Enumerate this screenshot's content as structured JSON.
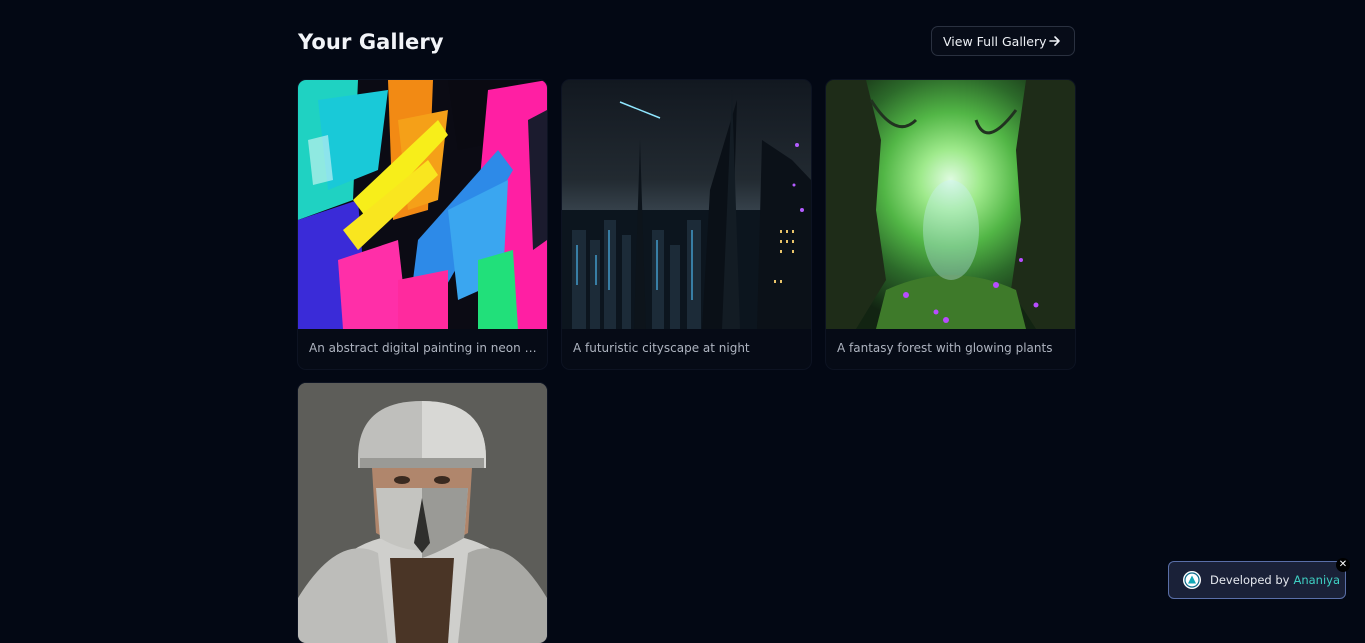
{
  "gallery": {
    "title": "Your Gallery",
    "view_full_label": "View Full Gallery"
  },
  "images": [
    {
      "caption": "An abstract digital painting in neon colors",
      "icon": "abstract-painting"
    },
    {
      "caption": "A futuristic cityscape at night",
      "icon": "cityscape"
    },
    {
      "caption": "A fantasy forest with glowing plants",
      "icon": "forest"
    },
    {
      "caption": "",
      "icon": "knight-portrait"
    }
  ],
  "badge": {
    "prefix": "Developed by",
    "author": "Ananiya",
    "close_glyph": "✕",
    "accent_color": "#3fd0c3"
  },
  "colors": {
    "background": "#030814",
    "badge_border": "#5a6fa8"
  }
}
